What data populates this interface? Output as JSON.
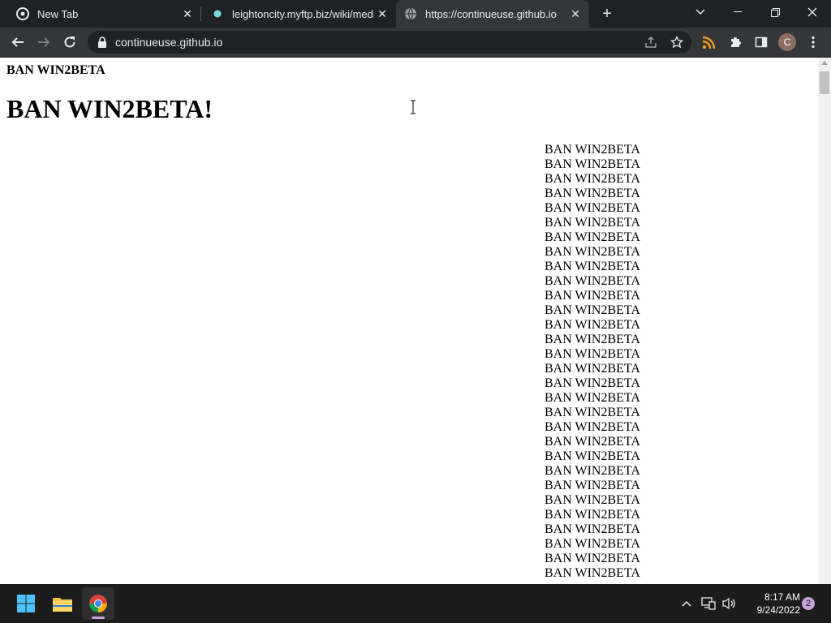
{
  "browser": {
    "tabs": [
      {
        "title": "New Tab",
        "icon": "chrome-icon"
      },
      {
        "title": "leightoncity.myftp.biz/wiki/media",
        "icon": "site-favicon"
      },
      {
        "title": "https://continueuse.github.io",
        "icon": "globe-icon",
        "active": true
      }
    ],
    "url": "continueuse.github.io",
    "profile_initial": "C"
  },
  "page": {
    "small_heading": "BAN WIN2BETA",
    "big_heading": "BAN WIN2BETA!",
    "repeated_line": "BAN WIN2BETA",
    "repeat_count_visible": 30
  },
  "taskbar": {
    "time": "8:17 AM",
    "date": "9/24/2022",
    "notification_count": "2"
  },
  "colors": {
    "tab_strip": "#202124",
    "toolbar": "#35363a",
    "page_bg": "#ffffff",
    "taskbar": "#1c1c1c",
    "accent": "#c9a3d9"
  }
}
